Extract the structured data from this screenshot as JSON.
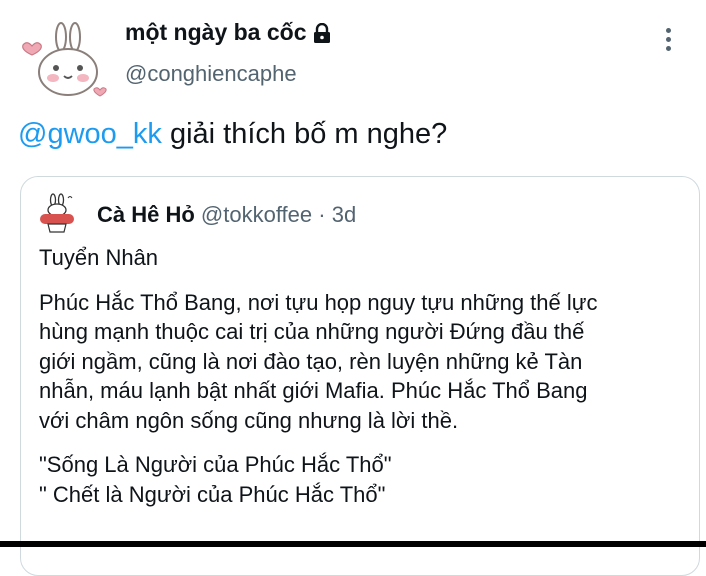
{
  "author": {
    "display_name": "một ngày ba cốc",
    "handle": "@conghiencaphe",
    "avatar_icon": "bunny-avatar-icon",
    "locked_icon": "lock-icon"
  },
  "tweet": {
    "mention": "@gwoo_kk",
    "text": " giải thích bố m nghe?"
  },
  "quoted": {
    "display_name": "Cà Hê Hỏ",
    "handle": "@tokkoffee",
    "separator": " · ",
    "time": "3d",
    "avatar_icon": "tokkoffee-logo-icon",
    "paragraph1": "Tuyển Nhân",
    "paragraph2_lines": [
      "Phúc Hắc Thổ Bang, nơi tựu họp nguy tựu những thế lực",
      "hùng mạnh thuộc cai trị của những người Đứng đầu thế",
      "giới ngầm, cũng là nơi đào tạo, rèn luyện những kẻ Tàn",
      "nhẫn, máu lạnh bật nhất giới Mafia. Phúc Hắc Thổ Bang",
      "với châm ngôn sống cũng nhưng là lời thề."
    ],
    "quote_lines": [
      "\"Sống Là Người của Phúc Hắc Thổ\"",
      "\" Chết là Người của Phúc Hắc Thổ\""
    ]
  },
  "colors": {
    "link": "#1d9bf0",
    "secondary_text": "#536471",
    "border": "#cfd9de"
  }
}
